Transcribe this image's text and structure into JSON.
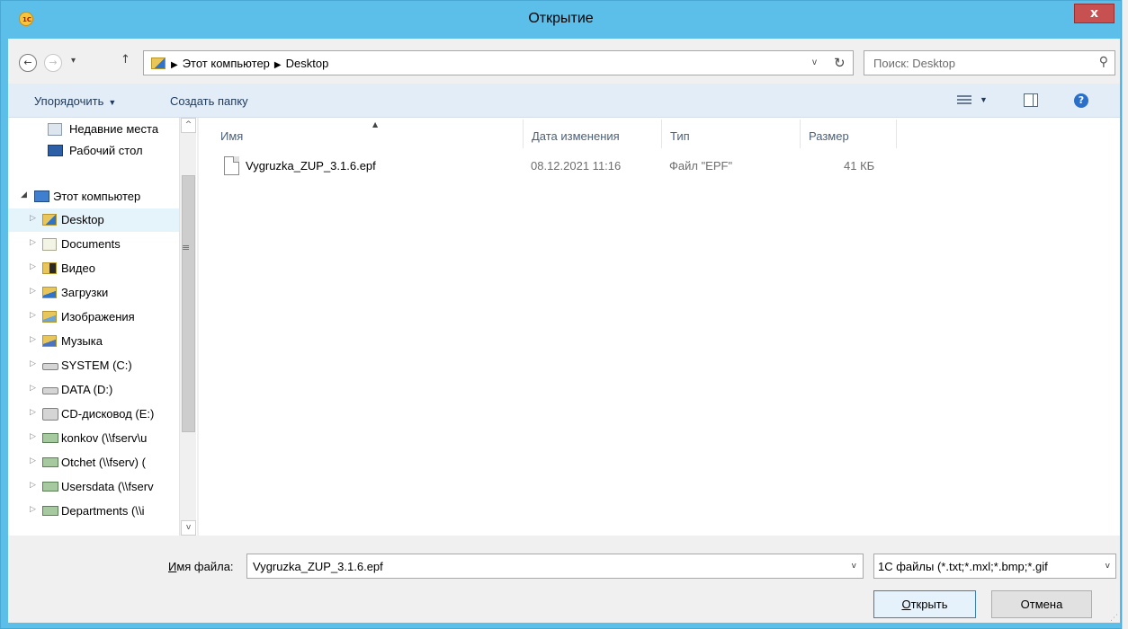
{
  "window": {
    "title": "Открытие",
    "close_glyph": "x",
    "app_icon_text": "1С"
  },
  "nav": {
    "back_glyph": "←",
    "forward_glyph": "→",
    "history_glyph": "▾",
    "up_glyph": "↑"
  },
  "address": {
    "sep": "▶",
    "crumb_1": "Этот компьютер",
    "crumb_2": "Desktop",
    "dropdown_glyph": "v",
    "refresh_glyph": "↻"
  },
  "search": {
    "placeholder": "Поиск: Desktop",
    "icon_glyph": "⚲"
  },
  "toolbar": {
    "organize_label": "Упорядочить",
    "organize_arrow": "▼",
    "new_folder_label": "Создать папку",
    "view_arrow": "▼",
    "help_glyph": "?"
  },
  "sidebar": {
    "items": [
      {
        "label": "Недавние места",
        "icon": "recent-places-icon"
      },
      {
        "label": "Рабочий стол",
        "icon": "desktop-icon"
      },
      {
        "label": "Этот компьютер",
        "icon": "computer-icon",
        "arrow": "◢"
      },
      {
        "label": "Desktop",
        "icon": "desktop-folder-icon",
        "arrow": "▷"
      },
      {
        "label": "Documents",
        "icon": "documents-folder-icon",
        "arrow": "▷"
      },
      {
        "label": "Видео",
        "icon": "video-folder-icon",
        "arrow": "▷"
      },
      {
        "label": "Загрузки",
        "icon": "downloads-folder-icon",
        "arrow": "▷"
      },
      {
        "label": "Изображения",
        "icon": "pictures-folder-icon",
        "arrow": "▷"
      },
      {
        "label": "Музыка",
        "icon": "music-folder-icon",
        "arrow": "▷"
      },
      {
        "label": "SYSTEM (C:)",
        "icon": "drive-icon",
        "arrow": "▷"
      },
      {
        "label": "DATA (D:)",
        "icon": "drive-icon",
        "arrow": "▷"
      },
      {
        "label": "CD-дисковод (E:)",
        "icon": "cd-drive-icon",
        "arrow": "▷"
      },
      {
        "label": "konkov (\\\\fserv\\u",
        "icon": "network-drive-icon",
        "arrow": "▷"
      },
      {
        "label": "Otchet (\\\\fserv) (",
        "icon": "network-drive-icon",
        "arrow": "▷"
      },
      {
        "label": "Usersdata (\\\\fserv",
        "icon": "network-drive-icon",
        "arrow": "▷"
      },
      {
        "label": "Departments (\\\\i",
        "icon": "network-drive-icon",
        "arrow": "▷"
      }
    ],
    "scroll_up_glyph": "^",
    "scroll_down_glyph": "v",
    "scroll_grip_glyph": "≡"
  },
  "columns": {
    "name": "Имя",
    "date": "Дата изменения",
    "type": "Тип",
    "size": "Размер",
    "sort_glyph": "▲"
  },
  "files": [
    {
      "name": "Vygruzka_ZUP_3.1.6.epf",
      "date": "08.12.2021 11:16",
      "type": "Файл \"EPF\"",
      "size": "41 КБ"
    }
  ],
  "footer": {
    "filename_label_u": "И",
    "filename_label_rest": "мя файла:",
    "filename_value": "Vygruzka_ZUP_3.1.6.epf",
    "filter_value": "1С файлы (*.txt;*.mxl;*.bmp;*.gif",
    "dropdown_glyph": "v",
    "open_label_u": "О",
    "open_label_rest": "ткрыть",
    "cancel_label": "Отмена",
    "grip_glyph": "⋰"
  }
}
